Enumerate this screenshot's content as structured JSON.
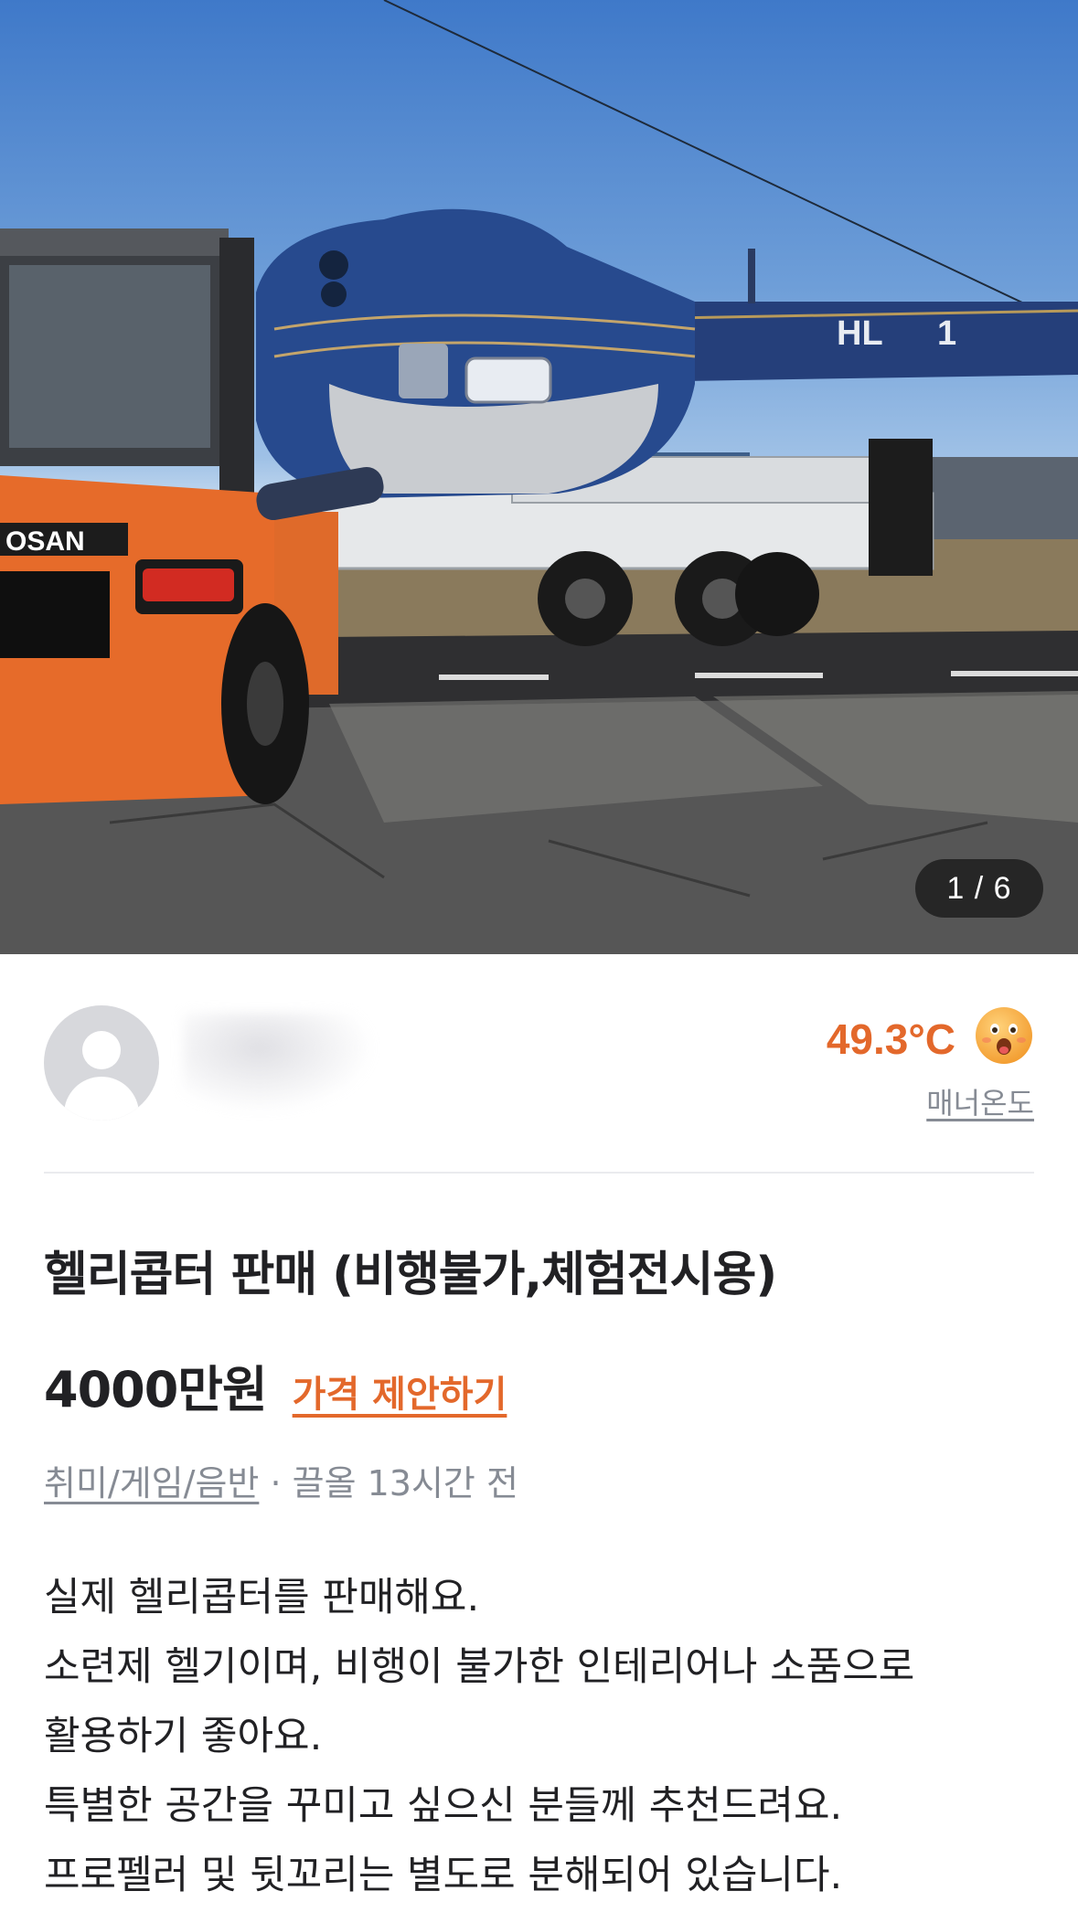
{
  "photo": {
    "counter": "1 / 6",
    "forklift_brand": "OSAN",
    "helicopter_reg": "HL",
    "helicopter_reg_num": "1"
  },
  "seller": {
    "temperature": "49.3°C",
    "manner_label": "매너온도",
    "colors": {
      "temperature": "#e3682b",
      "manner": "#868b94"
    }
  },
  "listing": {
    "title": "헬리콥터 판매 (비행불가,체험전시용)",
    "price": "4000만원",
    "offer_link": "가격 제안하기",
    "category": "취미/게임/음반",
    "time": " · 끌올 13시간 전",
    "description": [
      "실제 헬리콥터를 판매해요.",
      "소련제 헬기이며, 비행이 불가한 인테리어나 소품으로",
      "활용하기 좋아요.",
      "특별한 공간을 꾸미고 싶으신 분들께 추천드려요.",
      "프로펠러 및 뒷꼬리는 별도로 분해되어 있습니다."
    ]
  },
  "icons": {
    "avatar": "default-user-icon",
    "temperature_emoji": "smiling-face-icon"
  },
  "colors": {
    "accent": "#e3682b",
    "text": "#212124",
    "muted": "#868b94"
  }
}
